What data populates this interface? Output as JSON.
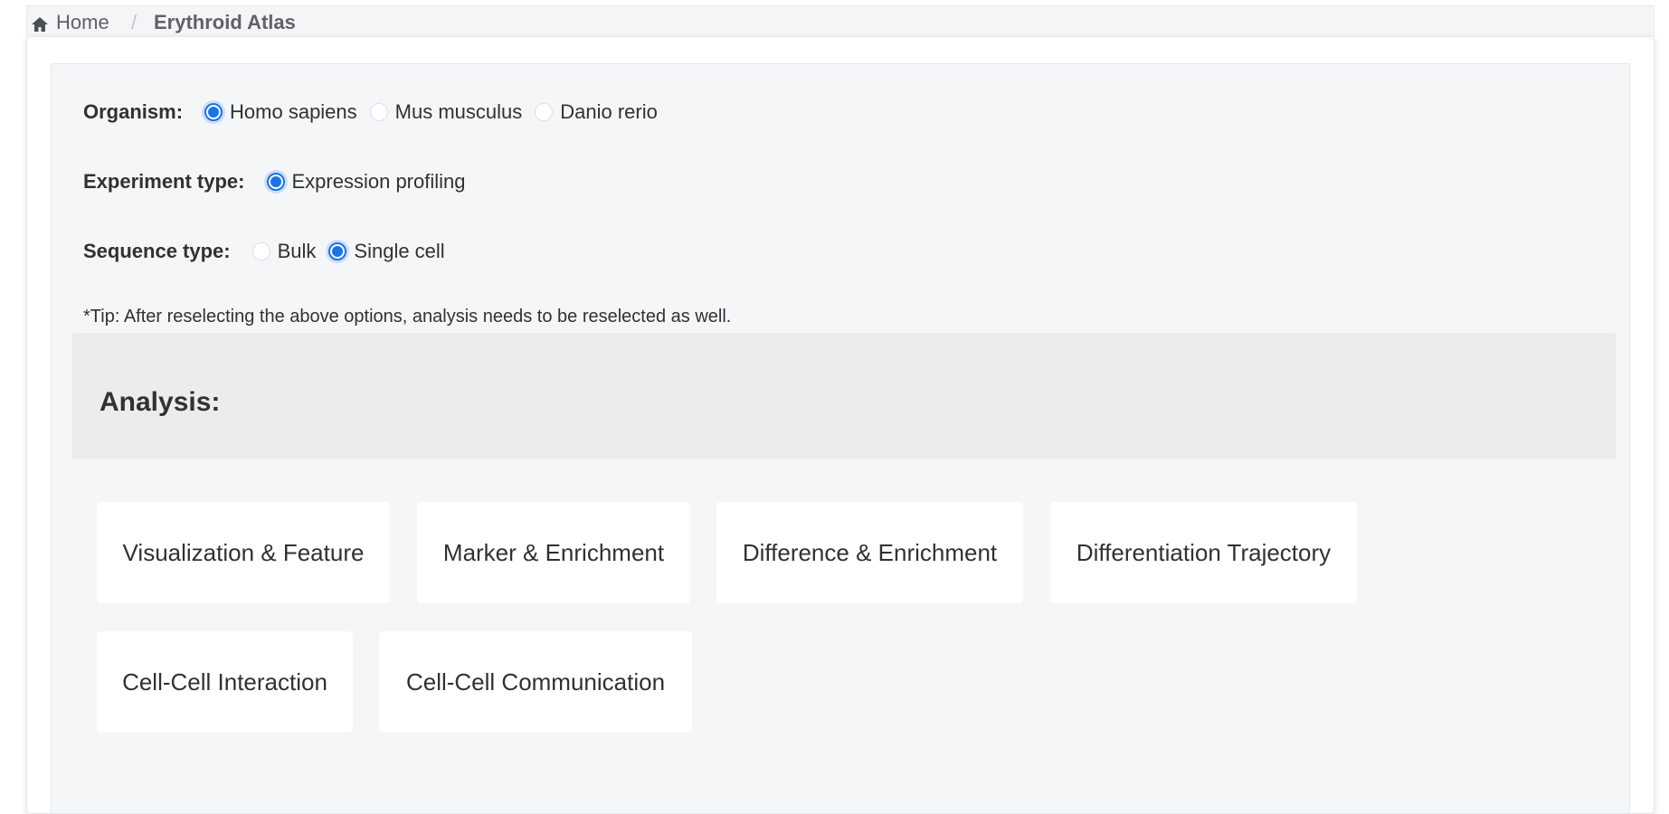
{
  "breadcrumb": {
    "home_icon": "home-icon",
    "home_label": "Home",
    "separator": "/",
    "current": "Erythroid Atlas"
  },
  "filters": {
    "organism": {
      "label": "Organism:",
      "options": [
        {
          "label": "Homo sapiens",
          "checked": true
        },
        {
          "label": "Mus musculus",
          "checked": false
        },
        {
          "label": "Danio rerio",
          "checked": false
        }
      ]
    },
    "experiment_type": {
      "label": "Experiment type:",
      "options": [
        {
          "label": "Expression profiling",
          "checked": true
        }
      ]
    },
    "sequence_type": {
      "label": "Sequence type:",
      "options": [
        {
          "label": "Bulk",
          "checked": false
        },
        {
          "label": "Single cell",
          "checked": true
        }
      ]
    }
  },
  "tip": "*Tip: After reselecting the above options, analysis needs to be reselected as well.",
  "analysis": {
    "title": "Analysis:",
    "items": [
      "Visualization & Feature",
      "Marker & Enrichment",
      "Difference & Enrichment",
      "Differentiation Trajectory",
      "Cell-Cell Interaction",
      "Cell-Cell Communication"
    ]
  },
  "colors": {
    "accent": "#1a73e8",
    "panel_background": "#f5f6f8",
    "analysis_header_background": "#ececec"
  }
}
